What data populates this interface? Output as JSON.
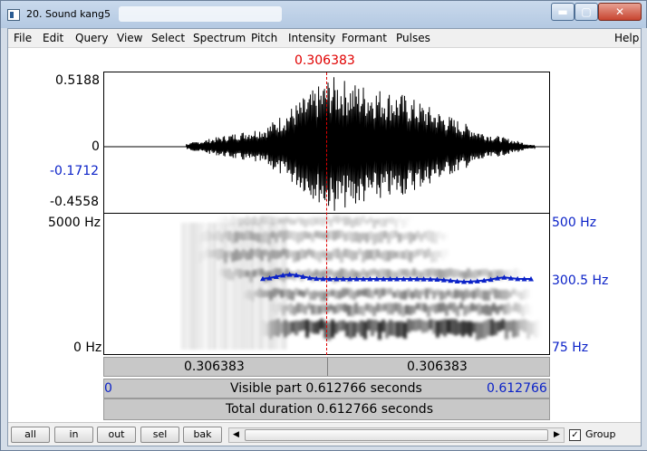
{
  "window": {
    "title": "20. Sound kang5",
    "minimize_glyph": "▬",
    "maximize_glyph": "▢",
    "close_glyph": "✕"
  },
  "menu": {
    "items": [
      "File",
      "Edit",
      "Query",
      "View",
      "Select",
      "Spectrum",
      "Pitch",
      "Intensity",
      "Formant",
      "Pulses"
    ],
    "help": "Help"
  },
  "cursor": {
    "time_label": "0.306383"
  },
  "waveform": {
    "max_label": "0.5188",
    "zero_label": "0",
    "cursor_value_label": "-0.1712",
    "min_label": "-0.4558"
  },
  "spectrogram": {
    "top_freq_label": "5000 Hz",
    "bottom_freq_label": "0 Hz",
    "pitch_top_label": "500 Hz",
    "pitch_value_label": "300.5 Hz",
    "pitch_bottom_label": "75 Hz"
  },
  "time_bars": {
    "left_segment": "0.306383",
    "right_segment": "0.306383",
    "start": "0",
    "visible": "Visible part 0.612766 seconds",
    "end": "0.612766",
    "total": "Total duration 0.612766 seconds"
  },
  "toolbar": {
    "buttons": [
      "all",
      "in",
      "out",
      "sel",
      "bak"
    ],
    "scroll_left": "◀",
    "scroll_right": "▶",
    "group_label": "Group",
    "group_checked": "✓"
  },
  "colors": {
    "cursor": "#e00000",
    "pitch": "#0b22c8",
    "titlebar": "#b4c9e2"
  }
}
